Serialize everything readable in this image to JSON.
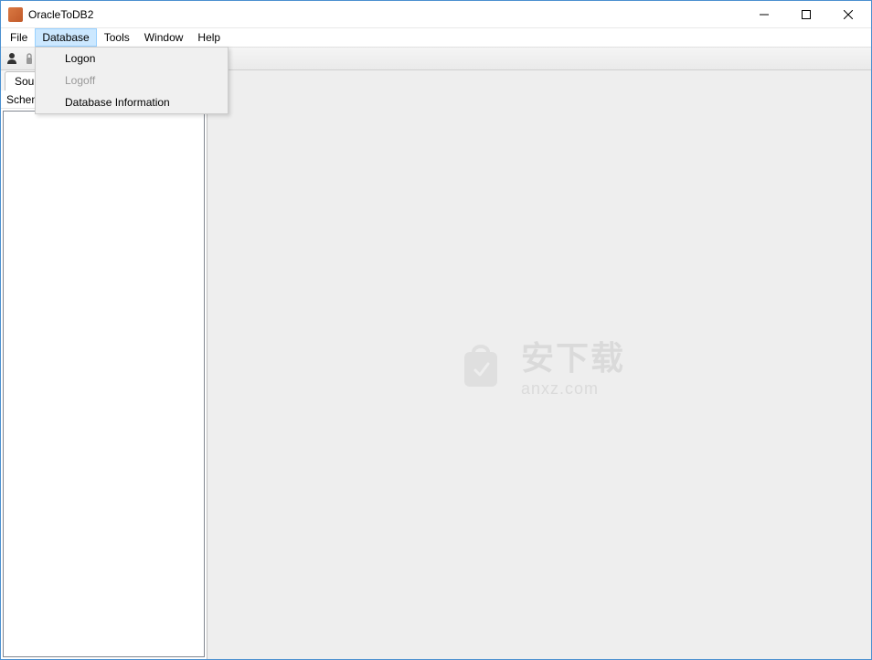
{
  "window": {
    "title": "OracleToDB2"
  },
  "menubar": {
    "items": [
      "File",
      "Database",
      "Tools",
      "Window",
      "Help"
    ],
    "active_index": 1
  },
  "dropdown": {
    "items": [
      {
        "label": "Logon",
        "enabled": true
      },
      {
        "label": "Logoff",
        "enabled": false
      },
      {
        "label": "Database Information",
        "enabled": true
      }
    ]
  },
  "sidebar": {
    "tab_label": "Source",
    "schema_label": "Schema"
  },
  "watermark": {
    "text_main": "安下载",
    "text_sub": "anxz.com"
  }
}
